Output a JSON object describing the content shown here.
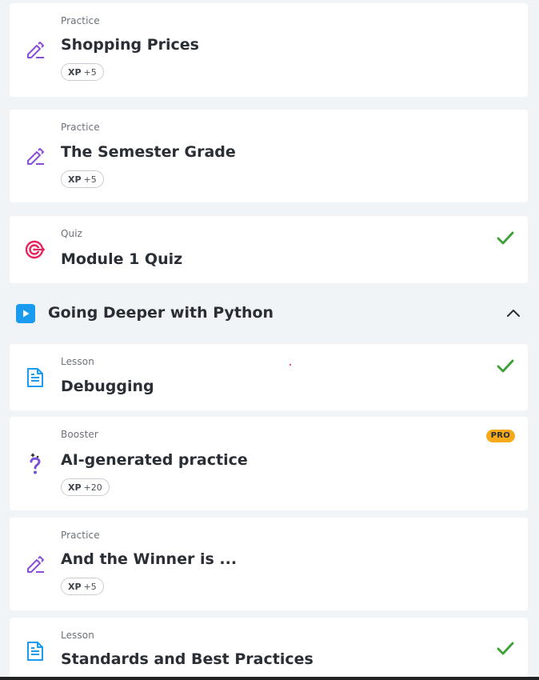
{
  "colors": {
    "practice_icon": "#8a4fd8",
    "quiz_icon": "#e5245d",
    "lesson_icon": "#1a9bf0",
    "booster_icon": "#7b4fd8",
    "check": "#3aa135",
    "pro_badge": "#f6a91a",
    "section_play": "#1a9bf0"
  },
  "cards_before": [
    {
      "type": "Practice",
      "title": "Shopping Prices",
      "xp_label": "XP",
      "xp_value": "+5",
      "icon": "pencil-icon",
      "completed": false
    },
    {
      "type": "Practice",
      "title": "The Semester Grade",
      "xp_label": "XP",
      "xp_value": "+5",
      "icon": "pencil-icon",
      "completed": false
    },
    {
      "type": "Quiz",
      "title": "Module 1 Quiz",
      "icon": "target-icon",
      "completed": true
    }
  ],
  "section": {
    "title": "Going Deeper with Python",
    "icon": "play-icon",
    "toggle_icon": "chevron-up-icon"
  },
  "cards_after": [
    {
      "type": "Lesson",
      "title": "Debugging",
      "icon": "document-icon",
      "completed": true
    },
    {
      "type": "Booster",
      "title": "AI-generated practice",
      "xp_label": "XP",
      "xp_value": "+20",
      "icon": "sparkle-question-icon",
      "badge": "PRO",
      "completed": false
    },
    {
      "type": "Practice",
      "title": "And the Winner is ...",
      "xp_label": "XP",
      "xp_value": "+5",
      "icon": "pencil-icon",
      "completed": false
    },
    {
      "type": "Lesson",
      "title": "Standards and Best Practices",
      "icon": "document-icon",
      "completed": true
    }
  ]
}
